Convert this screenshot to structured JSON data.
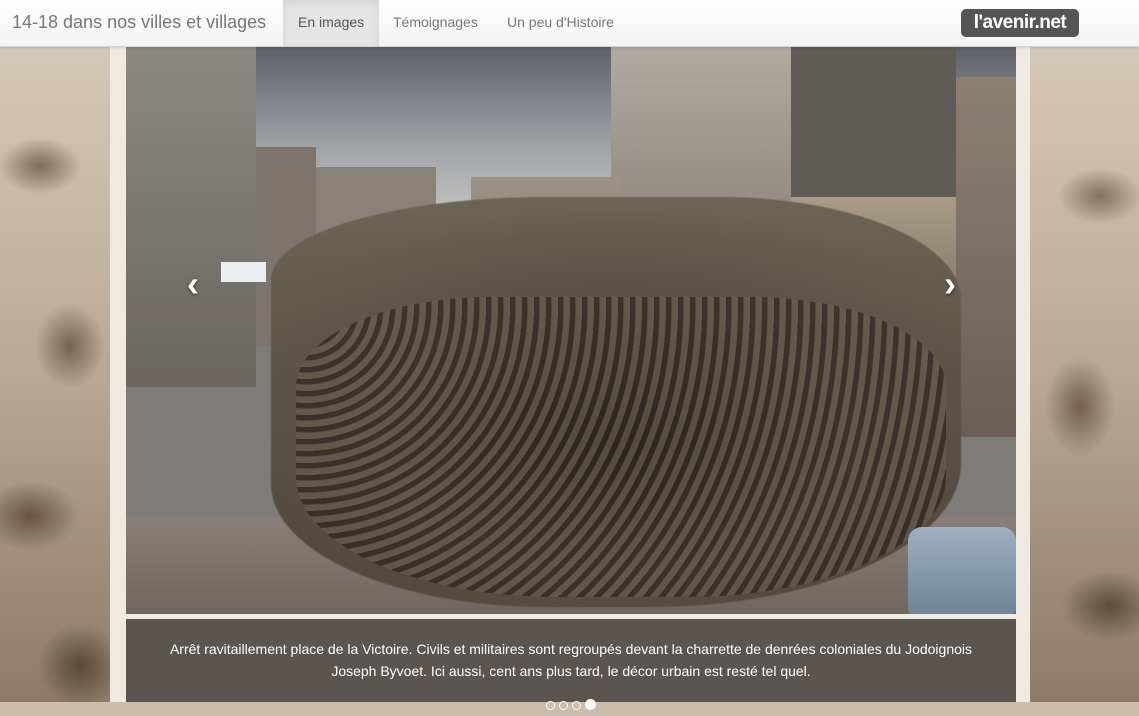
{
  "navbar": {
    "brand": "14-18 dans nos villes et villages",
    "items": [
      {
        "label": "En images",
        "active": true
      },
      {
        "label": "Témoignages",
        "active": false
      },
      {
        "label": "Un peu d'Histoire",
        "active": false
      }
    ],
    "logo": "l'avenir.net"
  },
  "carousel": {
    "prev_icon": "chevron-left-icon",
    "next_icon": "chevron-right-icon",
    "prev_glyph": "‹",
    "next_glyph": "›",
    "caption": "Arrêt ravitaillement place de la Victoire. Civils et militaires sont regroupés devant la charrette de denrées coloniales du Jodoignois Joseph Byvoet. Ici aussi, cent ans plus tard, le décor urbain est resté tel quel.",
    "slide_count": 4,
    "active_slide": 4
  },
  "colors": {
    "navbar_bg": "#f8f8f8",
    "nav_active_bg": "#e5e5e5",
    "logo_bg": "#555555",
    "caption_bg": "#46403c"
  }
}
